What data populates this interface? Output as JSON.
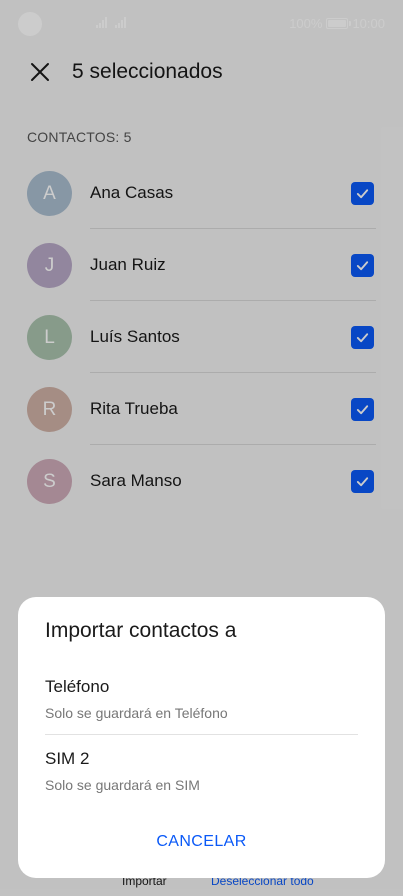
{
  "status_bar": {
    "battery_text": "100%",
    "time": "10:00"
  },
  "header": {
    "title": "5 seleccionados"
  },
  "contacts_section": {
    "label": "CONTACTOS: 5"
  },
  "contacts": [
    {
      "initial": "A",
      "name": "Ana Casas",
      "avatar_color": "#a9bdcf"
    },
    {
      "initial": "J",
      "name": "Juan Ruiz",
      "avatar_color": "#b7a8c6"
    },
    {
      "initial": "L",
      "name": "Luís Santos",
      "avatar_color": "#a9c2ad"
    },
    {
      "initial": "R",
      "name": "Rita Trueba",
      "avatar_color": "#cfb1a5"
    },
    {
      "initial": "S",
      "name": "Sara Manso",
      "avatar_color": "#cdaab8"
    }
  ],
  "bottom_toolbar": {
    "import_label": "Importar",
    "deselect_label": "Deseleccionar todo"
  },
  "dialog": {
    "title": "Importar contactos a",
    "options": [
      {
        "title": "Teléfono",
        "subtitle": "Solo se guardará en Teléfono"
      },
      {
        "title": "SIM 2",
        "subtitle": "Solo se guardará en SIM"
      }
    ],
    "cancel_label": "CANCELAR"
  },
  "colors": {
    "accent": "#0a59f7",
    "scrim": "rgba(0,0,0,0.20)"
  }
}
